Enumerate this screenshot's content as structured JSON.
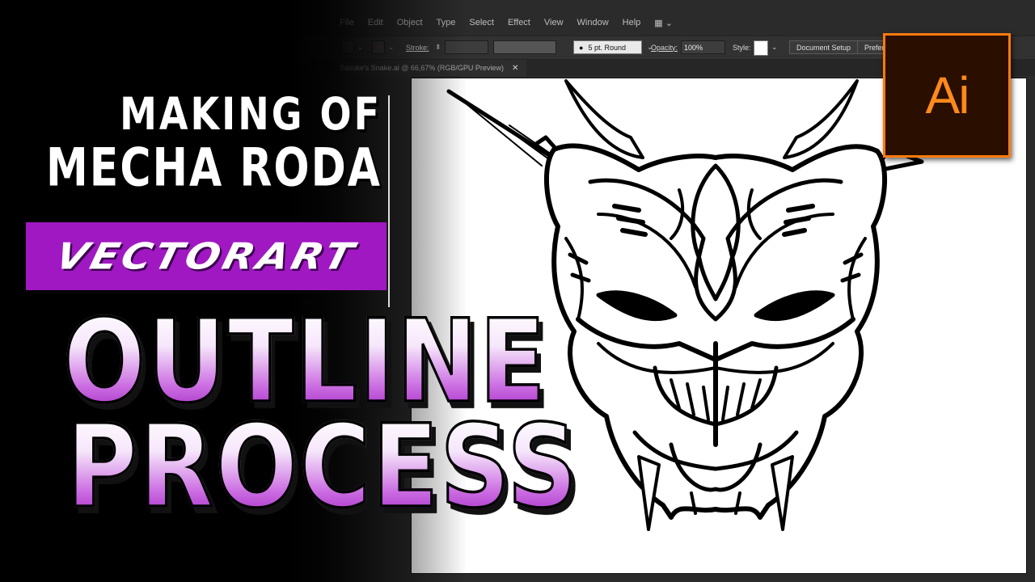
{
  "menu": [
    "File",
    "Edit",
    "Object",
    "Type",
    "Select",
    "Effect",
    "View",
    "Window",
    "Help"
  ],
  "control_bar": {
    "stroke_label": "Stroke:",
    "brush": "5 pt. Round",
    "opacity_label": "Opacity:",
    "opacity_value": "100%",
    "style_label": "Style:",
    "document_setup": "Document Setup",
    "preferences": "Prefere"
  },
  "document_tab": {
    "title": "Sasuke's Snake.ai @ 66,67% (RGB/GPU Preview)",
    "close": "✕"
  },
  "logo": {
    "text": "Ai",
    "color": "#ff7b0f"
  },
  "overlay": {
    "line1": "MAKING OF",
    "line2": "MECHA RODA",
    "band": "VECTORART",
    "band_color": "#a018c2",
    "big1": "OUTLINE",
    "big2": "PROCESS"
  }
}
